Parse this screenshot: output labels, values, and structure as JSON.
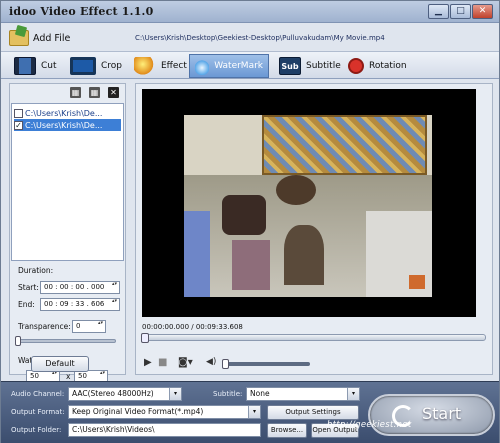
{
  "window": {
    "title": "idoo Video Effect 1.1.0"
  },
  "toolbar": {
    "add_file_label": "Add File",
    "file_path": "C:\\Users\\Krish\\Desktop\\Geekiest-Desktop\\Pulluvakudam\\My Movie.mp4"
  },
  "tabs": [
    {
      "label": "Cut",
      "icon": "film-icon"
    },
    {
      "label": "Crop",
      "icon": "crop-icon"
    },
    {
      "label": "Effect",
      "icon": "sparkle-icon"
    },
    {
      "label": "WaterMark",
      "icon": "watermark-icon",
      "active": true
    },
    {
      "label": "Subtitle",
      "icon": "subtitle-icon"
    },
    {
      "label": "Rotation",
      "icon": "rotation-icon"
    }
  ],
  "watermark_list": [
    {
      "text": "C:\\Users\\Krish\\De...",
      "checked": false,
      "selected": false
    },
    {
      "text": "C:\\Users\\Krish\\De...",
      "checked": true,
      "selected": true
    }
  ],
  "settings": {
    "duration_label": "Duration:",
    "start_label": "Start:",
    "start_value": "00 : 00 : 00 . 000",
    "end_label": "End:",
    "end_value": "00 : 09 : 33 . 606",
    "transparence_label": "Transparence:",
    "transparence_value": "0",
    "watermark_size_label": "Watermark Size:",
    "size_w": "50",
    "size_sep": "x",
    "size_h": "50",
    "default_button": "Default"
  },
  "player": {
    "time_display": "00:00:00.000 / 00:09:33.608",
    "seek_fraction": 0.0,
    "volume_fraction": 0.0
  },
  "bottom": {
    "audio_channel_label": "Audio Channel:",
    "audio_channel_value": "AAC(Stereo 48000Hz)",
    "subtitle_label": "Subtitle:",
    "subtitle_value": "None",
    "output_format_label": "Output Format:",
    "output_format_value": "Keep Original Video Format(*.mp4)",
    "output_settings_button": "Output Settings",
    "output_folder_label": "Output Folder:",
    "output_folder_value": "C:\\Users\\Krish\\Videos\\",
    "browse_button": "Browse...",
    "open_output_button": "Open Output",
    "start_button": "Start"
  },
  "overlay_text": "http://geekiest.net"
}
